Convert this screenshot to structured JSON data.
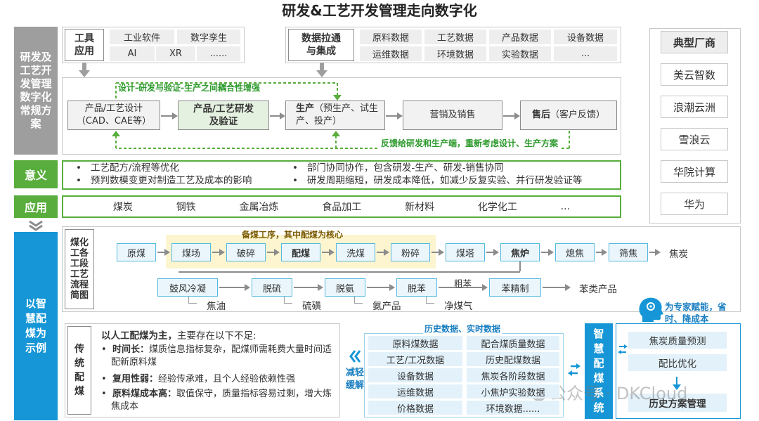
{
  "title": "研发&工艺开发管理走向数字化",
  "side": {
    "rd": "研发及工艺开发管理数字化常规方案",
    "meaning": "意义",
    "application": "应用",
    "smart": "以智慧配煤为示例"
  },
  "tools": {
    "label": "工具应用",
    "items": [
      "工业软件",
      "数字孪生",
      "AI",
      "XR",
      "......"
    ]
  },
  "data_integration": {
    "label": "数据拉通与集成",
    "items": [
      "原料数据",
      "工艺数据",
      "产品数据",
      "设备数据",
      "运维数据",
      "环境数据",
      "实验数据",
      "..."
    ]
  },
  "flow": {
    "coupling_label": "设计-研发与验证-生产之间耦合性增强",
    "feedback_label": "反馈给研发和生产端，重新考虑设计、生产方案",
    "steps": [
      {
        "bold": "",
        "text": "产品/工艺设计（CAD、CAE等）"
      },
      {
        "bold": "产品/工艺研发及验证",
        "text": ""
      },
      {
        "bold": "生产",
        "text": "（预生产、试生产、投产）"
      },
      {
        "bold": "",
        "text": "营销及销售"
      },
      {
        "bold": "售后",
        "text": "（客户反馈）"
      }
    ]
  },
  "meaning": {
    "left": [
      "工艺配方/流程等优化",
      "预判数模变更对制造工艺及成本的影响"
    ],
    "right": [
      "部门协同协作，包含研发-生产、研发-销售协同",
      "研发周期缩短，研发成本降低，如减少反复实验、并行研发验证等"
    ]
  },
  "applications": [
    "煤炭",
    "钢铁",
    "金属冶炼",
    "食品加工",
    "新材料",
    "化学化工",
    "..."
  ],
  "vendors": {
    "label": "典型厂商",
    "items": [
      "美云智数",
      "浪潮云洲",
      "雪浪云",
      "华院计算",
      "华为"
    ]
  },
  "coking": {
    "label": "煤化工各工段工艺流程简图",
    "highlight_label": "备煤工序，其中配煤为核心",
    "main": [
      "原煤",
      "煤场",
      "破碎",
      "配煤",
      "洗煤",
      "粉碎",
      "煤塔",
      "焦炉",
      "熄焦",
      "筛焦"
    ],
    "main_end": "焦炭",
    "gas": [
      "鼓风冷凝",
      "脱硫",
      "脱氨",
      "脱苯",
      "苯精制"
    ],
    "gas_end": "苯类产品",
    "crude_benzene": "粗苯",
    "byproducts": [
      "焦油",
      "硫磺",
      "氨产品",
      "净煤气"
    ]
  },
  "traditional": {
    "label": "传统配煤",
    "heading_bold": "以人工配煤为主，",
    "heading_rest": "主要存在以下不足:",
    "issues": [
      {
        "bold": "时间长：",
        "text": "煤质信息指标复杂，配煤师需耗费大量时间适配新原料煤"
      },
      {
        "bold": "复用性弱：",
        "text": "经验传承难，且个人经验依赖性强"
      },
      {
        "bold": "原料煤成本高：",
        "text": "取值保守，质量指标容易过剩，增大炼焦成本"
      }
    ]
  },
  "relief": "减轻缓解",
  "data_panel": {
    "label": "历史数据、实时数据",
    "items": [
      "原料煤数据",
      "配合煤质量数据",
      "工艺/工况数据",
      "历史配煤数据",
      "设备数据",
      "焦炭各阶段数据",
      "运维数据",
      "小焦炉实验数据",
      "价格数据",
      "环境数据......"
    ]
  },
  "smart_system": {
    "label": "智慧配煤系统",
    "expert_label": "为专家赋能，省时、降成本",
    "features": [
      "焦炭质量预测",
      "配比优化",
      "历史方案管理"
    ]
  },
  "watermark": "公众号 · DKCloud",
  "colors": {
    "green": "#58ad3c",
    "blue": "#1696d6",
    "gray": "#9e9e9e",
    "highlight": "#fdf5d0"
  }
}
